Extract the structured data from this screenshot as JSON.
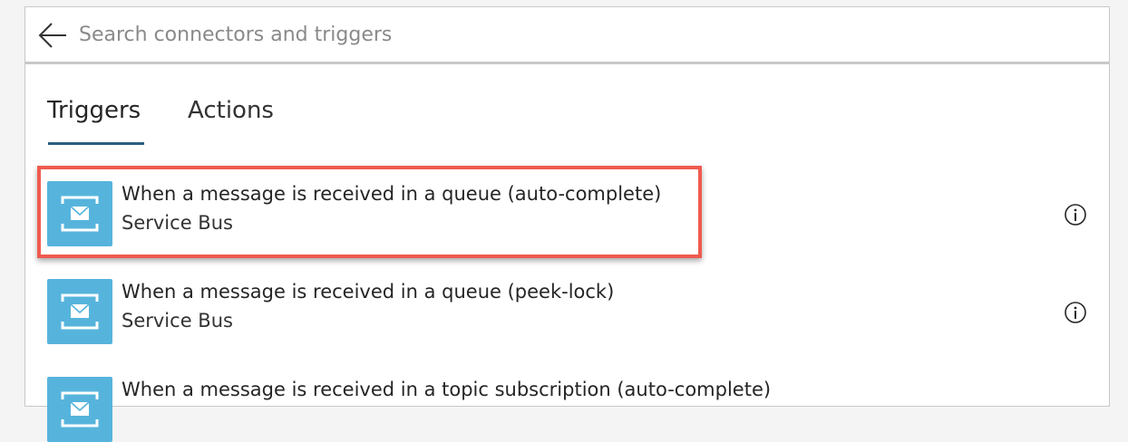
{
  "search": {
    "placeholder": "Search connectors and triggers",
    "value": ""
  },
  "tabs": [
    {
      "label": "Triggers",
      "selected": true
    },
    {
      "label": "Actions",
      "selected": false
    }
  ],
  "items": [
    {
      "title": "When a message is received in a queue (auto-complete)",
      "subtitle": "Service Bus",
      "icon": "service-bus-icon",
      "highlighted": true
    },
    {
      "title": "When a message is received in a queue (peek-lock)",
      "subtitle": "Service Bus",
      "icon": "service-bus-icon",
      "highlighted": false
    },
    {
      "title": "When a message is received in a topic subscription (auto-complete)",
      "subtitle": "",
      "icon": "service-bus-icon",
      "highlighted": false
    }
  ],
  "colors": {
    "accent": "#2b5e80",
    "icon_background": "#56b4dc",
    "highlight_border": "#f05a4f"
  }
}
